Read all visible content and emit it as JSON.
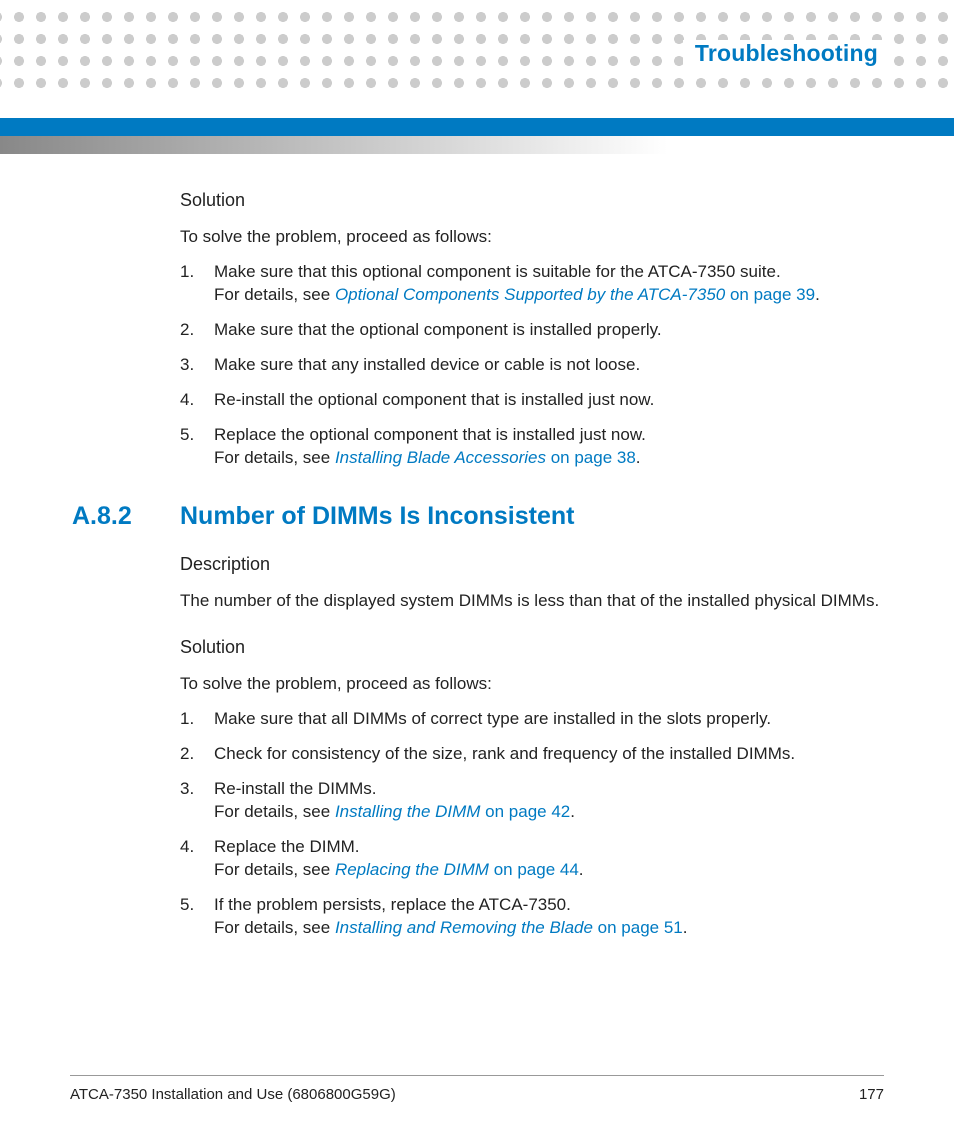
{
  "header": {
    "title": "Troubleshooting"
  },
  "section1": {
    "solution_head": "Solution",
    "intro": "To solve the problem, proceed as follows:",
    "steps": [
      {
        "text": "Make sure that this optional component is suitable for the ATCA-7350 suite.",
        "detail_prefix": "For details, see ",
        "link_text": "Optional Components Supported by the ATCA-7350",
        "link_suffix": " on page 39",
        "tail": "."
      },
      {
        "text": "Make sure that the optional component is installed properly."
      },
      {
        "text": "Make sure that any installed device or cable is not loose."
      },
      {
        "text": "Re-install the optional component that is installed just now."
      },
      {
        "text": "Replace the optional component that is installed just now.",
        "detail_prefix": "For details, see ",
        "link_text": "Installing Blade Accessories",
        "link_suffix": " on page 38",
        "tail": "."
      }
    ]
  },
  "section2": {
    "number": "A.8.2",
    "title": "Number of DIMMs Is Inconsistent",
    "desc_head": "Description",
    "desc_text": "The number of the displayed system DIMMs is less than that of the installed physical DIMMs.",
    "solution_head": "Solution",
    "intro": "To solve the problem, proceed as follows:",
    "steps": [
      {
        "text": "Make sure that all DIMMs of correct type are installed in the slots properly."
      },
      {
        "text": "Check for consistency of the size, rank and frequency of the installed DIMMs."
      },
      {
        "text": "Re-install the DIMMs.",
        "detail_prefix": "For details, see ",
        "link_text": "Installing the DIMM",
        "link_suffix": " on page 42",
        "tail": "."
      },
      {
        "text": "Replace the DIMM.",
        "detail_prefix": "For details, see ",
        "link_text": "Replacing the DIMM",
        "link_suffix": " on page 44",
        "tail": "."
      },
      {
        "text": "If the problem persists, replace the ATCA-7350.",
        "detail_prefix": "For details, see ",
        "link_text": "Installing and Removing the Blade",
        "link_suffix": " on page 51",
        "tail": "."
      }
    ]
  },
  "footer": {
    "doc": "ATCA-7350 Installation and Use (6806800G59G)",
    "page": "177"
  }
}
